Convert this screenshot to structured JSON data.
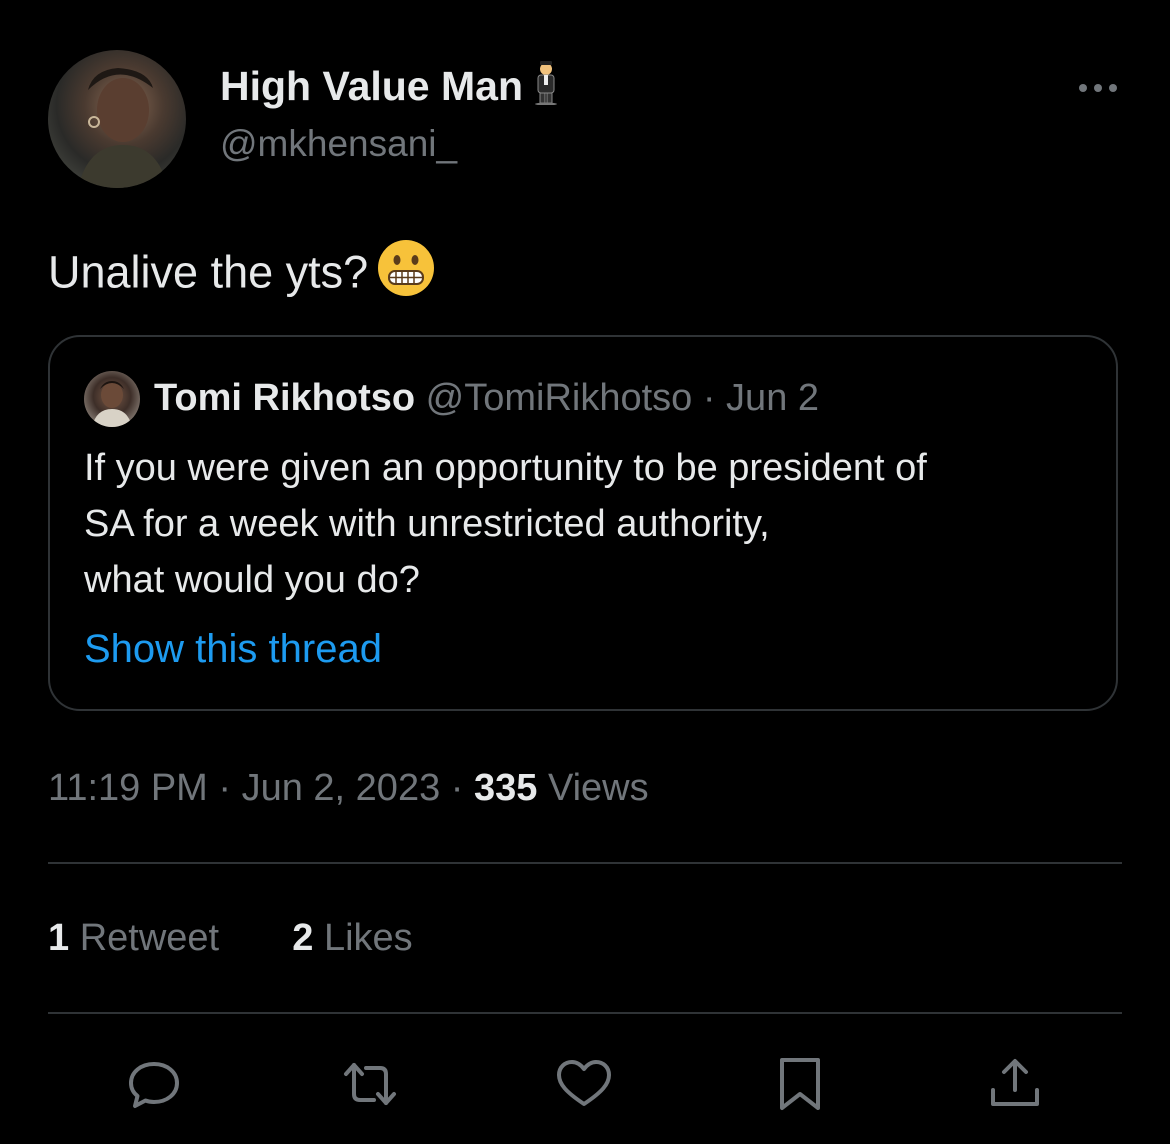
{
  "author": {
    "name": "High Value Man",
    "name_emoji": "man-in-suit-levitating",
    "handle": "@mkhensani_"
  },
  "menu_icon": "more-icon",
  "tweet": {
    "text": "Unalive the yts?",
    "emoji": "grimacing-face"
  },
  "quote": {
    "name": "Tomi Rikhotso",
    "meta": "@TomiRikhotso · Jun 2",
    "lines": [
      "If you were given an opportunity to be president of",
      "SA for a week with unrestricted authority,",
      "what would you do?"
    ],
    "link": "Show this thread"
  },
  "meta": {
    "time_date": "11:19 PM · Jun 2, 2023 · ",
    "views_count": "335",
    "views_label": " Views"
  },
  "stats": {
    "retweets_count": "1",
    "retweets_label": "Retweet",
    "likes_count": "2",
    "likes_label": "Likes"
  },
  "actions": [
    "reply-icon",
    "retweet-icon",
    "like-icon",
    "bookmark-icon",
    "share-icon"
  ],
  "colors": {
    "background": "#000000",
    "text": "#e7e9ea",
    "secondary": "#71767b",
    "link": "#1d9bf0",
    "border": "#2f3336"
  }
}
